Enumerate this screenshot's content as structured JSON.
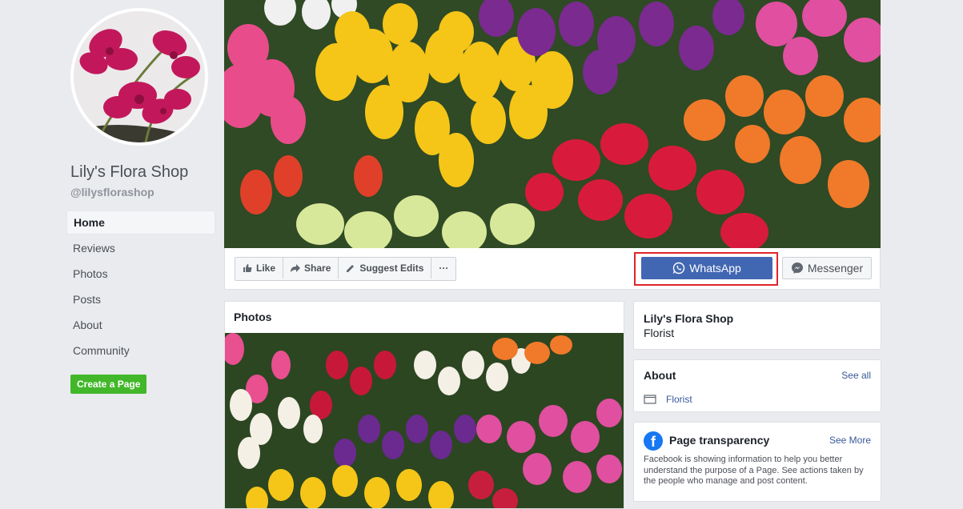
{
  "profile": {
    "name": "Lily's Flora Shop",
    "handle": "@lilysflorashop"
  },
  "nav": {
    "items": [
      {
        "label": "Home"
      },
      {
        "label": "Reviews"
      },
      {
        "label": "Photos"
      },
      {
        "label": "Posts"
      },
      {
        "label": "About"
      },
      {
        "label": "Community"
      }
    ],
    "create_page": "Create a Page"
  },
  "actions": {
    "like": "Like",
    "share": "Share",
    "suggest_edits": "Suggest Edits",
    "more": "···",
    "whatsapp": "WhatsApp",
    "messenger": "Messenger"
  },
  "photos": {
    "title": "Photos"
  },
  "info": {
    "name": "Lily's Flora Shop",
    "category": "Florist"
  },
  "about": {
    "title": "About",
    "see_all": "See all",
    "category": "Florist"
  },
  "transparency": {
    "icon_letter": "f",
    "title": "Page transparency",
    "see_more": "See More",
    "description": "Facebook is showing information to help you better understand the purpose of a Page. See actions taken by the people who manage and post content."
  },
  "colors": {
    "whatsapp_button": "#4267b2",
    "highlight": "#e0242b",
    "create_page": "#42b72a",
    "link": "#385898"
  },
  "icons": [
    "thumbs-up-icon",
    "share-arrow-icon",
    "pencil-icon",
    "whatsapp-icon",
    "messenger-icon",
    "flag-icon",
    "facebook-icon"
  ]
}
